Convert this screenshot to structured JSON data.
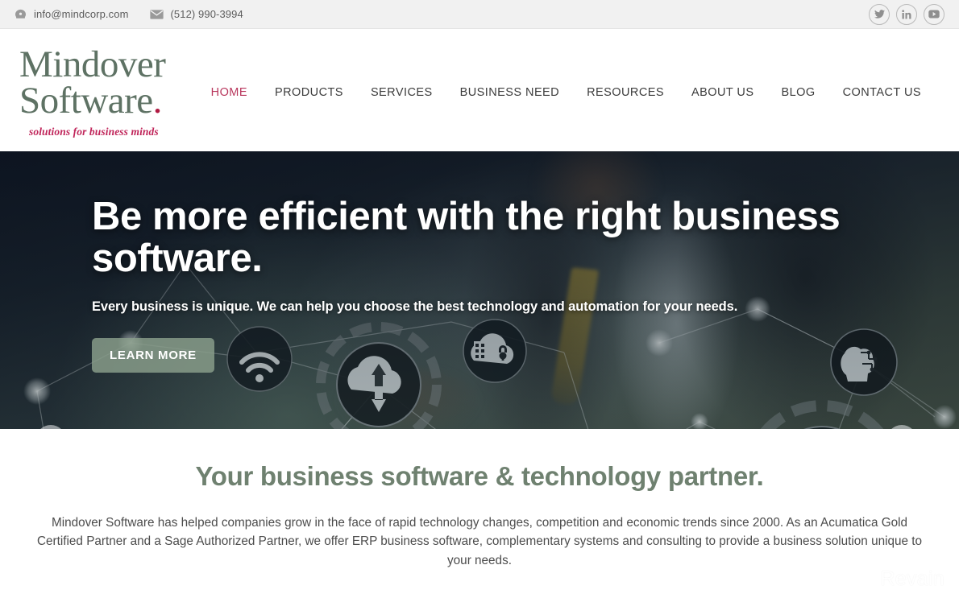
{
  "topbar": {
    "email": "info@mindcorp.com",
    "phone": "(512) 990-3994",
    "email_icon": "phone-circle-icon",
    "phone_icon": "envelope-icon",
    "social": [
      {
        "name": "twitter-icon",
        "label": "Twitter"
      },
      {
        "name": "linkedin-icon",
        "label": "LinkedIn"
      },
      {
        "name": "youtube-icon",
        "label": "YouTube"
      }
    ],
    "bg_color": "#f1f1f1",
    "text_color": "#5c5c5c"
  },
  "logo": {
    "line1": "Mindover",
    "line2": "Software",
    "dot": ".",
    "tagline": "solutions for business minds",
    "green": "#5e7264",
    "crimson": "#c0255a"
  },
  "nav": {
    "items": [
      {
        "label": "HOME",
        "active": true
      },
      {
        "label": "PRODUCTS",
        "active": false
      },
      {
        "label": "SERVICES",
        "active": false
      },
      {
        "label": "BUSINESS NEED",
        "active": false
      },
      {
        "label": "RESOURCES",
        "active": false
      },
      {
        "label": "ABOUT US",
        "active": false
      },
      {
        "label": "BLOG",
        "active": false
      },
      {
        "label": "CONTACT US",
        "active": false
      }
    ],
    "active_color": "#b8365c",
    "color": "#3d3d3d"
  },
  "hero": {
    "title": "Be more efficient with the right business software.",
    "subtitle": "Every business is unique. We can help you choose the best technology and automation for your needs.",
    "button_label": "LEARN MORE",
    "button_color": "#8ba08c",
    "prev_icon": "chevron-left-icon",
    "next_icon": "chevron-right-icon",
    "background_icons": [
      "wifi-icon",
      "cloud-upload-download-icon",
      "cloud-lock-building-icon",
      "brain-circuit-icon",
      "padlock-icon",
      "mobile-lock-icon",
      "cloud-keyhole-grid-icon"
    ]
  },
  "intro": {
    "heading": "Your business software & technology partner.",
    "heading_color": "#6f8170",
    "paragraph": "Mindover Software has helped companies grow in the face of rapid technology changes, competition and economic trends since 2000. As an Acumatica Gold Certified Partner and a Sage Authorized Partner, we offer ERP business software, complementary systems and consulting to provide a business solution unique to your needs."
  },
  "watermark": {
    "text": "Revain",
    "logo_icon": "revain-magnifier-icon"
  }
}
